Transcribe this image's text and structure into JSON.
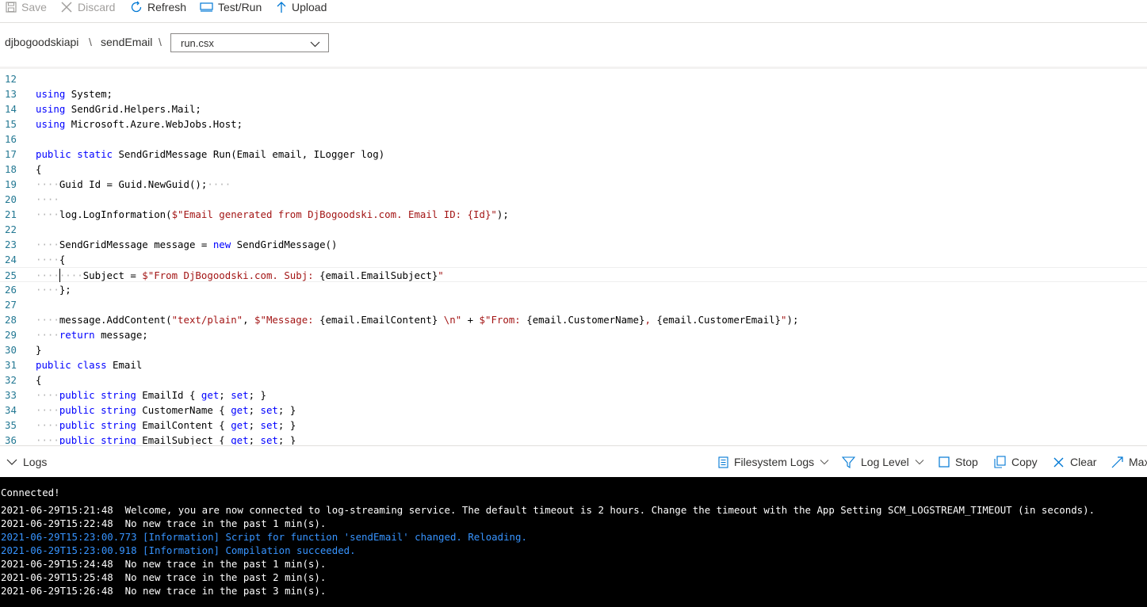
{
  "toolbar": {
    "save": "Save",
    "discard": "Discard",
    "refresh": "Refresh",
    "test_run": "Test/Run",
    "upload": "Upload"
  },
  "breadcrumb": {
    "app": "djbogoodskiapi",
    "function": "sendEmail",
    "separator": "\\",
    "file": "run.csx"
  },
  "editor": {
    "lines": [
      {
        "n": "12",
        "tokens": []
      },
      {
        "n": "13",
        "tokens": [
          {
            "t": "using",
            "c": "kw"
          },
          {
            "t": " System;",
            "c": ""
          }
        ]
      },
      {
        "n": "14",
        "tokens": [
          {
            "t": "using",
            "c": "kw"
          },
          {
            "t": " SendGrid.Helpers.Mail;",
            "c": ""
          }
        ]
      },
      {
        "n": "15",
        "tokens": [
          {
            "t": "using",
            "c": "kw"
          },
          {
            "t": " Microsoft.Azure.WebJobs.Host;",
            "c": ""
          }
        ]
      },
      {
        "n": "16",
        "tokens": []
      },
      {
        "n": "17",
        "tokens": [
          {
            "t": "public",
            "c": "kw"
          },
          {
            "t": " ",
            "c": ""
          },
          {
            "t": "static",
            "c": "kw"
          },
          {
            "t": " SendGridMessage Run(Email email, ILogger log)",
            "c": ""
          }
        ]
      },
      {
        "n": "18",
        "tokens": [
          {
            "t": "{",
            "c": ""
          }
        ]
      },
      {
        "n": "19",
        "tokens": [
          {
            "t": "····",
            "c": "ws"
          },
          {
            "t": "Guid Id = Guid.NewGuid();",
            "c": ""
          },
          {
            "t": "····",
            "c": "ws"
          }
        ]
      },
      {
        "n": "20",
        "tokens": [
          {
            "t": "····",
            "c": "ws"
          }
        ]
      },
      {
        "n": "21",
        "tokens": [
          {
            "t": "····",
            "c": "ws"
          },
          {
            "t": "log.LogInformation(",
            "c": ""
          },
          {
            "t": "$\"Email generated from DjBogoodski.com. Email ID: {Id}\"",
            "c": "str"
          },
          {
            "t": ");",
            "c": ""
          }
        ]
      },
      {
        "n": "22",
        "tokens": []
      },
      {
        "n": "23",
        "tokens": [
          {
            "t": "····",
            "c": "ws"
          },
          {
            "t": "SendGridMessage message = ",
            "c": ""
          },
          {
            "t": "new",
            "c": "kw"
          },
          {
            "t": " SendGridMessage()",
            "c": ""
          }
        ]
      },
      {
        "n": "24",
        "tokens": [
          {
            "t": "····",
            "c": "ws"
          },
          {
            "t": "{",
            "c": ""
          }
        ]
      },
      {
        "n": "25",
        "tokens": [
          {
            "t": "········",
            "c": "ws"
          },
          {
            "t": "Subject = ",
            "c": ""
          },
          {
            "t": "$\"From DjBogoodski.com. Subj: ",
            "c": "str"
          },
          {
            "t": "{email.EmailSubject}",
            "c": ""
          },
          {
            "t": "\"",
            "c": "str"
          }
        ],
        "active": true
      },
      {
        "n": "26",
        "tokens": [
          {
            "t": "····",
            "c": "ws"
          },
          {
            "t": "};",
            "c": ""
          }
        ]
      },
      {
        "n": "27",
        "tokens": []
      },
      {
        "n": "28",
        "tokens": [
          {
            "t": "····",
            "c": "ws"
          },
          {
            "t": "message.AddContent(",
            "c": ""
          },
          {
            "t": "\"text/plain\"",
            "c": "str"
          },
          {
            "t": ", ",
            "c": ""
          },
          {
            "t": "$\"Message: ",
            "c": "str"
          },
          {
            "t": "{email.EmailContent}",
            "c": ""
          },
          {
            "t": " \\n\"",
            "c": "str"
          },
          {
            "t": " + ",
            "c": ""
          },
          {
            "t": "$\"From: ",
            "c": "str"
          },
          {
            "t": "{email.CustomerName}",
            "c": ""
          },
          {
            "t": ", ",
            "c": "str"
          },
          {
            "t": "{email.CustomerEmail}",
            "c": ""
          },
          {
            "t": "\"",
            "c": "str"
          },
          {
            "t": ");",
            "c": ""
          }
        ]
      },
      {
        "n": "29",
        "tokens": [
          {
            "t": "····",
            "c": "ws"
          },
          {
            "t": "return",
            "c": "kw"
          },
          {
            "t": " message;",
            "c": ""
          }
        ]
      },
      {
        "n": "30",
        "tokens": [
          {
            "t": "}",
            "c": ""
          }
        ]
      },
      {
        "n": "31",
        "tokens": [
          {
            "t": "public",
            "c": "kw"
          },
          {
            "t": " ",
            "c": ""
          },
          {
            "t": "class",
            "c": "kw"
          },
          {
            "t": " Email",
            "c": ""
          }
        ]
      },
      {
        "n": "32",
        "tokens": [
          {
            "t": "{",
            "c": ""
          }
        ]
      },
      {
        "n": "33",
        "tokens": [
          {
            "t": "····",
            "c": "ws"
          },
          {
            "t": "public",
            "c": "kw"
          },
          {
            "t": " ",
            "c": ""
          },
          {
            "t": "string",
            "c": "kw"
          },
          {
            "t": " EmailId { ",
            "c": ""
          },
          {
            "t": "get",
            "c": "kw"
          },
          {
            "t": "; ",
            "c": ""
          },
          {
            "t": "set",
            "c": "kw"
          },
          {
            "t": "; }",
            "c": ""
          }
        ]
      },
      {
        "n": "34",
        "tokens": [
          {
            "t": "····",
            "c": "ws"
          },
          {
            "t": "public",
            "c": "kw"
          },
          {
            "t": " ",
            "c": ""
          },
          {
            "t": "string",
            "c": "kw"
          },
          {
            "t": " CustomerName { ",
            "c": ""
          },
          {
            "t": "get",
            "c": "kw"
          },
          {
            "t": "; ",
            "c": ""
          },
          {
            "t": "set",
            "c": "kw"
          },
          {
            "t": "; }",
            "c": ""
          }
        ]
      },
      {
        "n": "35",
        "tokens": [
          {
            "t": "····",
            "c": "ws"
          },
          {
            "t": "public",
            "c": "kw"
          },
          {
            "t": " ",
            "c": ""
          },
          {
            "t": "string",
            "c": "kw"
          },
          {
            "t": " EmailContent { ",
            "c": ""
          },
          {
            "t": "get",
            "c": "kw"
          },
          {
            "t": "; ",
            "c": ""
          },
          {
            "t": "set",
            "c": "kw"
          },
          {
            "t": "; }",
            "c": ""
          }
        ]
      },
      {
        "n": "36",
        "tokens": [
          {
            "t": "····",
            "c": "ws"
          },
          {
            "t": "public",
            "c": "kw"
          },
          {
            "t": " ",
            "c": ""
          },
          {
            "t": "string",
            "c": "kw"
          },
          {
            "t": " EmailSubject { ",
            "c": ""
          },
          {
            "t": "get",
            "c": "kw"
          },
          {
            "t": "; ",
            "c": ""
          },
          {
            "t": "set",
            "c": "kw"
          },
          {
            "t": "; }",
            "c": ""
          }
        ]
      }
    ]
  },
  "logs": {
    "title": "Logs",
    "source": "Filesystem Logs",
    "level": "Log Level",
    "stop": "Stop",
    "copy": "Copy",
    "clear": "Clear",
    "maximize": "Maximize"
  },
  "console": {
    "lines": [
      {
        "text": "Connected!",
        "kind": "normal"
      },
      {
        "text": "2021-06-29T15:21:48  Welcome, you are now connected to log-streaming service. The default timeout is 2 hours. Change the timeout with the App Setting SCM_LOGSTREAM_TIMEOUT (in seconds).",
        "kind": "normal"
      },
      {
        "text": "2021-06-29T15:22:48  No new trace in the past 1 min(s).",
        "kind": "normal"
      },
      {
        "text": "2021-06-29T15:23:00.773 [Information] Script for function 'sendEmail' changed. Reloading.",
        "kind": "info"
      },
      {
        "text": "2021-06-29T15:23:00.918 [Information] Compilation succeeded.",
        "kind": "info"
      },
      {
        "text": "2021-06-29T15:24:48  No new trace in the past 1 min(s).",
        "kind": "normal"
      },
      {
        "text": "2021-06-29T15:25:48  No new trace in the past 2 min(s).",
        "kind": "normal"
      },
      {
        "text": "2021-06-29T15:26:48  No new trace in the past 3 min(s).",
        "kind": "normal"
      }
    ]
  }
}
